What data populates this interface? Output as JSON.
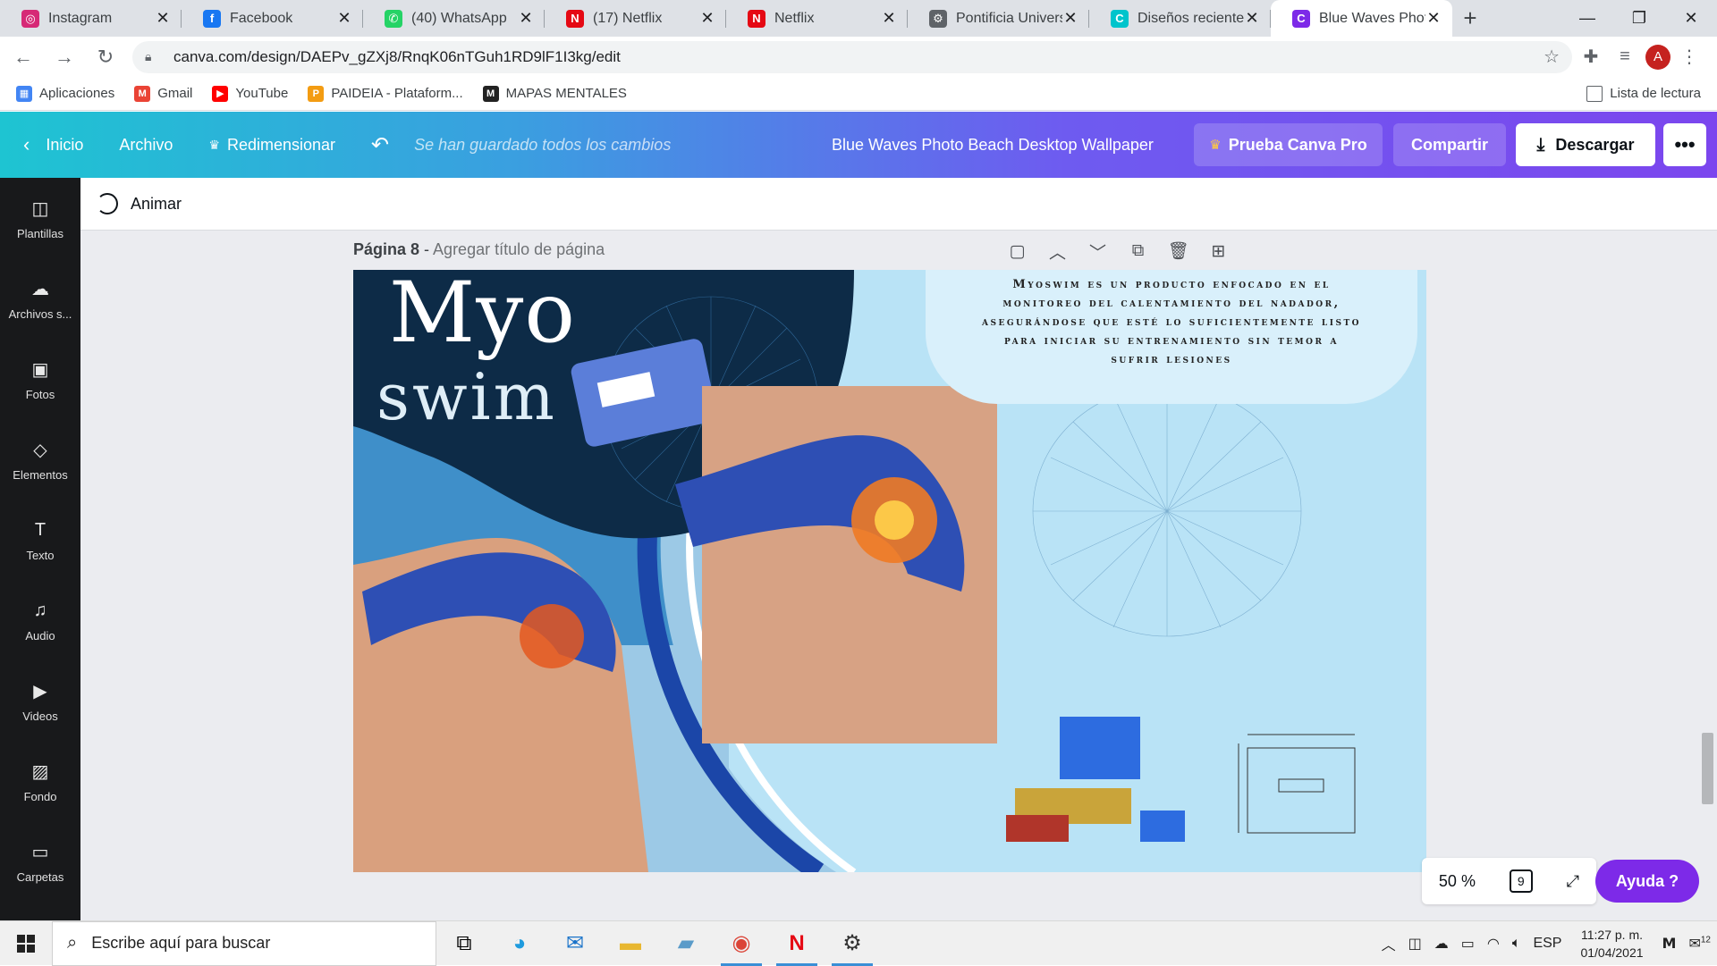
{
  "browser": {
    "tabs": [
      {
        "title": "Instagram",
        "icon": "instagram-icon",
        "color": "#d62976",
        "glyph": "◎"
      },
      {
        "title": "Facebook",
        "icon": "facebook-icon",
        "color": "#1877f2",
        "glyph": "f"
      },
      {
        "title": "(40) WhatsApp",
        "icon": "whatsapp-icon",
        "color": "#25d366",
        "glyph": "✆"
      },
      {
        "title": "(17) Netflix",
        "icon": "netflix-icon",
        "color": "#e50914",
        "glyph": "N"
      },
      {
        "title": "Netflix",
        "icon": "netflix-icon",
        "color": "#e50914",
        "glyph": "N"
      },
      {
        "title": "Pontificia Universid",
        "icon": "university-icon",
        "color": "#5f6368",
        "glyph": "⚙"
      },
      {
        "title": "Diseños recientes",
        "icon": "canva-icon",
        "color": "#00c4cc",
        "glyph": "C"
      },
      {
        "title": "Blue Waves Photo",
        "icon": "canva-icon",
        "color": "#7d2ae8",
        "glyph": "C"
      }
    ],
    "url": "canva.com/design/DAEPv_gZXj8/RnqK06nTGuh1RD9lF1I3kg/edit",
    "profile_initial": "A",
    "bookmarks": [
      {
        "label": "Aplicaciones",
        "color": "#4285f4",
        "glyph": "▦"
      },
      {
        "label": "Gmail",
        "color": "#ea4335",
        "glyph": "M"
      },
      {
        "label": "YouTube",
        "color": "#ff0000",
        "glyph": "▶"
      },
      {
        "label": "PAIDEIA - Plataform...",
        "color": "#f39c12",
        "glyph": "P"
      },
      {
        "label": "MAPAS MENTALES",
        "color": "#222222",
        "glyph": "M"
      }
    ],
    "reading_list": "Lista de lectura"
  },
  "canva": {
    "nav": {
      "home": "Inicio",
      "file": "Archivo",
      "resize": "Redimensionar",
      "saved": "Se han guardado todos los cambios"
    },
    "design_name": "Blue Waves Photo Beach Desktop Wallpaper",
    "pro_btn": "Prueba Canva Pro",
    "share_btn": "Compartir",
    "download_btn": "Descargar",
    "more_btn": "•••",
    "animate": "Animar",
    "sidebar": [
      {
        "label": "Plantillas",
        "icon": "templates-icon",
        "glyph": "◫"
      },
      {
        "label": "Archivos s...",
        "icon": "upload-icon",
        "glyph": "☁"
      },
      {
        "label": "Fotos",
        "icon": "photos-icon",
        "glyph": "▣"
      },
      {
        "label": "Elementos",
        "icon": "elements-icon",
        "glyph": "◇"
      },
      {
        "label": "Texto",
        "icon": "text-icon",
        "glyph": "T"
      },
      {
        "label": "Audio",
        "icon": "audio-icon",
        "glyph": "♫"
      },
      {
        "label": "Videos",
        "icon": "video-icon",
        "glyph": "▶"
      },
      {
        "label": "Fondo",
        "icon": "background-icon",
        "glyph": "▨"
      },
      {
        "label": "Carpetas",
        "icon": "folder-icon",
        "glyph": "▭"
      }
    ],
    "page": {
      "label": "Página 8",
      "separator": " - ",
      "add_title": "Agregar título de página"
    },
    "slide": {
      "title_line1": "Myo",
      "title_line2": "swim",
      "description": "Myoswim es un producto enfocado en el monitoreo del calentamiento del nadador, asegurándose que esté lo suficientemente listo para iniciar su entrenamiento sin temor a sufrir lesiones"
    },
    "zoom": "50 %",
    "page_count": "9",
    "help": "Ayuda ?"
  },
  "taskbar": {
    "search_placeholder": "Escribe aquí para buscar",
    "lang": "ESP",
    "time": "11:27 p. m.",
    "date": "01/04/2021",
    "notifications": "12"
  },
  "colors": {
    "canva_gradient_start": "#1ec4d2",
    "canva_gradient_end": "#7b46ee",
    "help_purple": "#7d2ae8",
    "slide_dark_navy": "#0d2b47",
    "slide_light_blue": "#b9e3f6"
  }
}
